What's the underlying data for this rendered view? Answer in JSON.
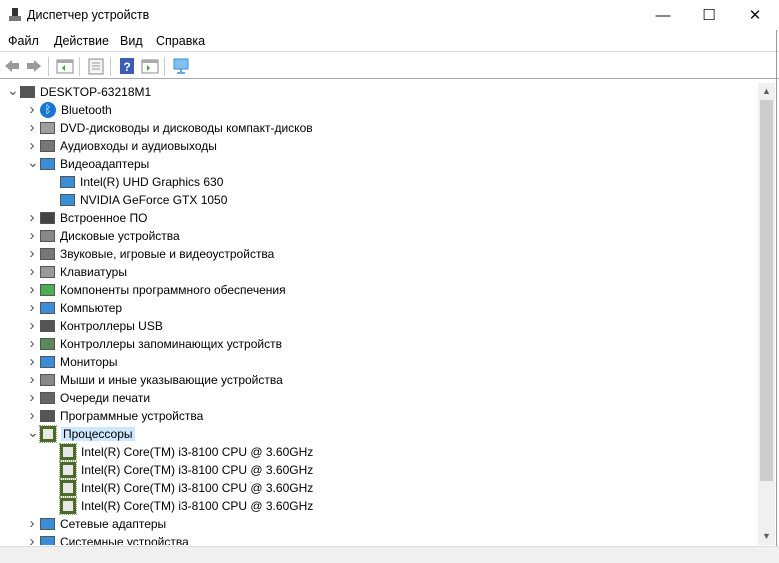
{
  "window": {
    "title": "Диспетчер устройств",
    "minimize": "—",
    "maximize": "☐",
    "close": "✕"
  },
  "menu": [
    "Файл",
    "Действие",
    "Вид",
    "Справка"
  ],
  "toolbar": [
    "back-icon",
    "forward-icon",
    "show-hide-tree-icon",
    "properties-icon",
    "help-icon",
    "run-icon",
    "scan-hardware-icon"
  ],
  "tree": [
    {
      "label": "DESKTOP-63218M1",
      "level": 0,
      "expanded": true,
      "icon": "computer-root-icon",
      "color": "#555555"
    },
    {
      "label": "Bluetooth",
      "level": 1,
      "icon": "bluetooth-icon",
      "color": "#1976d2"
    },
    {
      "label": "DVD-дисководы и дисководы компакт-дисков",
      "level": 1,
      "icon": "dvd-icon",
      "color": "#9e9e9e"
    },
    {
      "label": "Аудиовходы и аудиовыходы",
      "level": 1,
      "icon": "speaker-icon",
      "color": "#777777"
    },
    {
      "label": "Видеоадаптеры",
      "level": 1,
      "expanded": true,
      "icon": "display-adapter-icon",
      "color": "#3a8ed8"
    },
    {
      "label": "Intel(R) UHD Graphics 630",
      "level": 2,
      "icon": "display-adapter-icon",
      "color": "#3a8ed8"
    },
    {
      "label": "NVIDIA GeForce GTX 1050",
      "level": 2,
      "icon": "display-adapter-icon",
      "color": "#3a8ed8"
    },
    {
      "label": "Встроенное ПО",
      "level": 1,
      "icon": "firmware-icon",
      "color": "#444444"
    },
    {
      "label": "Дисковые устройства",
      "level": 1,
      "icon": "disk-icon",
      "color": "#888888"
    },
    {
      "label": "Звуковые, игровые и видеоустройства",
      "level": 1,
      "icon": "sound-icon",
      "color": "#777777"
    },
    {
      "label": "Клавиатуры",
      "level": 1,
      "icon": "keyboard-icon",
      "color": "#999999"
    },
    {
      "label": "Компоненты программного обеспечения",
      "level": 1,
      "icon": "software-component-icon",
      "color": "#4caf50"
    },
    {
      "label": "Компьютер",
      "level": 1,
      "icon": "computer-icon",
      "color": "#3a8ed8"
    },
    {
      "label": "Контроллеры USB",
      "level": 1,
      "icon": "usb-icon",
      "color": "#555555"
    },
    {
      "label": "Контроллеры запоминающих устройств",
      "level": 1,
      "icon": "storage-controller-icon",
      "color": "#5a8a5a"
    },
    {
      "label": "Мониторы",
      "level": 1,
      "icon": "monitor-icon",
      "color": "#3a8ed8"
    },
    {
      "label": "Мыши и иные указывающие устройства",
      "level": 1,
      "icon": "mouse-icon",
      "color": "#888888"
    },
    {
      "label": "Очереди печати",
      "level": 1,
      "icon": "printer-icon",
      "color": "#666666"
    },
    {
      "label": "Программные устройства",
      "level": 1,
      "icon": "software-device-icon",
      "color": "#555555"
    },
    {
      "label": "Процессоры",
      "level": 1,
      "expanded": true,
      "selected": true,
      "icon": "cpu-icon",
      "color": "#4a6b2a"
    },
    {
      "label": "Intel(R) Core(TM) i3-8100 CPU @ 3.60GHz",
      "level": 2,
      "icon": "cpu-icon",
      "color": "#4a6b2a"
    },
    {
      "label": "Intel(R) Core(TM) i3-8100 CPU @ 3.60GHz",
      "level": 2,
      "icon": "cpu-icon",
      "color": "#4a6b2a"
    },
    {
      "label": "Intel(R) Core(TM) i3-8100 CPU @ 3.60GHz",
      "level": 2,
      "icon": "cpu-icon",
      "color": "#4a6b2a"
    },
    {
      "label": "Intel(R) Core(TM) i3-8100 CPU @ 3.60GHz",
      "level": 2,
      "icon": "cpu-icon",
      "color": "#4a6b2a"
    },
    {
      "label": "Сетевые адаптеры",
      "level": 1,
      "icon": "network-adapter-icon",
      "color": "#3a8ed8"
    },
    {
      "label": "Системные устройства",
      "level": 1,
      "icon": "system-device-icon",
      "color": "#3a8ed8"
    }
  ],
  "selection_color": "#cce8ff"
}
